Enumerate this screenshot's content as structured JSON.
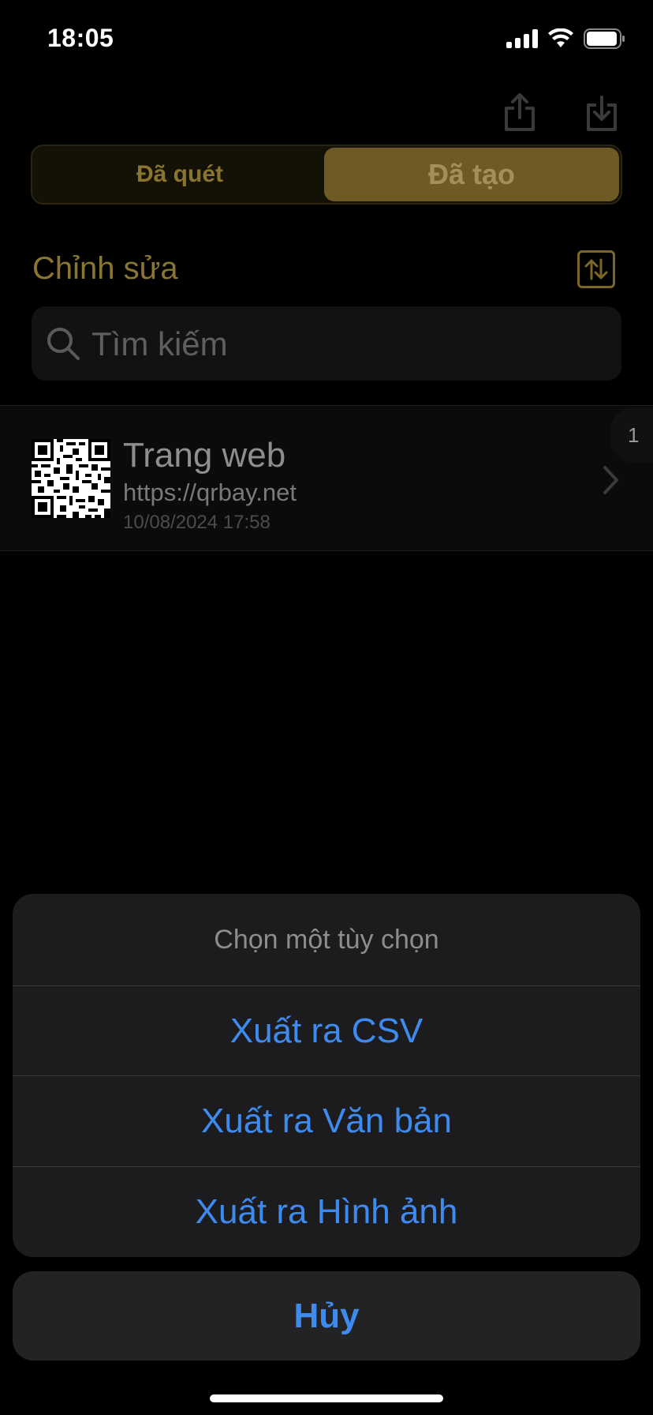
{
  "status_bar": {
    "time": "18:05",
    "icons": [
      "signal-icon",
      "wifi-icon",
      "battery-icon"
    ]
  },
  "toolbar": {
    "share_icon": "share-icon",
    "download_icon": "download-icon"
  },
  "segments": [
    {
      "label": "Đã quét",
      "selected": false
    },
    {
      "label": "Đã tạo",
      "selected": true
    }
  ],
  "edit": {
    "label": "Chỉnh sửa",
    "sort_icon": "sort-arrows-icon"
  },
  "search": {
    "placeholder": "Tìm kiếm"
  },
  "list": {
    "items": [
      {
        "title": "Trang web",
        "url": "https://qrbay.net",
        "date": "10/08/2024 17:58"
      }
    ],
    "index_badge": "1"
  },
  "action_sheet": {
    "title": "Chọn một tùy chọn",
    "options": [
      {
        "label": "Xuất ra CSV"
      },
      {
        "label": "Xuất ra Văn bản"
      },
      {
        "label": "Xuất ra Hình ảnh"
      }
    ],
    "cancel_label": "Hủy"
  },
  "colors": {
    "accent_gold": "#6f5a25",
    "action_blue": "#3e8bf0"
  }
}
